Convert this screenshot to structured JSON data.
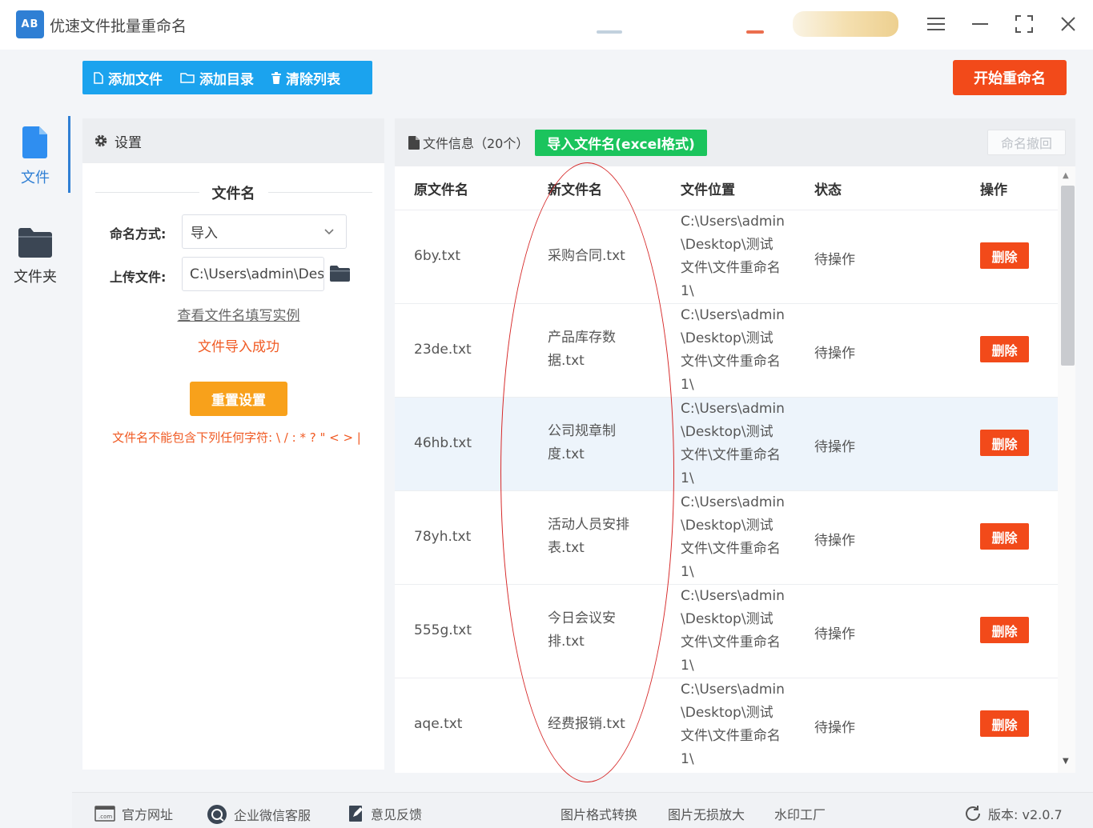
{
  "window": {
    "title": "优速文件批量重命名",
    "logo_text": "AB",
    "controls": [
      "menu-icon",
      "minimize-icon",
      "fullscreen-icon",
      "close-icon"
    ]
  },
  "nav": {
    "items": [
      {
        "label": "文件",
        "icon": "file-icon",
        "active": true
      },
      {
        "label": "文件夹",
        "icon": "folder-icon",
        "active": false
      }
    ]
  },
  "toolbar": {
    "add_files": "添加文件",
    "add_folder": "添加目录",
    "clear_list": "清除列表",
    "start_rename": "开始重命名"
  },
  "settings": {
    "header": "设置",
    "section_title": "文件名",
    "naming_mode_label": "命名方式:",
    "naming_mode_value": "导入",
    "upload_label": "上传文件:",
    "upload_value": "C:\\Users\\admin\\Desktop",
    "example_link": "查看文件名填写实例",
    "import_status": "文件导入成功",
    "reset_button": "重置设置",
    "warning": "文件名不能包含下列任何字符: \\ / : * ? \" < > |"
  },
  "file_table": {
    "info_label": "文件信息（20个）",
    "import_excel_button": "导入文件名(excel格式)",
    "undo_button": "命名撤回",
    "columns": [
      "原文件名",
      "新文件名",
      "文件位置",
      "状态",
      "操作"
    ],
    "rows": [
      {
        "original": "6by.txt",
        "new_line1": "采购合同.txt",
        "new_line2": "",
        "location": "C:\\Users\\admin\\Desktop\\测试文件\\文件重命名1\\",
        "status": "待操作",
        "action": "删除"
      },
      {
        "original": "23de.txt",
        "new_line1": "产品库存数",
        "new_line2": "据.txt",
        "location": "C:\\Users\\admin\\Desktop\\测试文件\\文件重命名1\\",
        "status": "待操作",
        "action": "删除"
      },
      {
        "original": "46hb.txt",
        "new_line1": "公司规章制",
        "new_line2": "度.txt",
        "location": "C:\\Users\\admin\\Desktop\\测试文件\\文件重命名1\\",
        "status": "待操作",
        "action": "删除"
      },
      {
        "original": "78yh.txt",
        "new_line1": "活动人员安排",
        "new_line2": "表.txt",
        "location": "C:\\Users\\admin\\Desktop\\测试文件\\文件重命名1\\",
        "status": "待操作",
        "action": "删除"
      },
      {
        "original": "555g.txt",
        "new_line1": "今日会议安",
        "new_line2": "排.txt",
        "location": "C:\\Users\\admin\\Desktop\\测试文件\\文件重命名1\\",
        "status": "待操作",
        "action": "删除"
      },
      {
        "original": "aqe.txt",
        "new_line1": "经费报销.txt",
        "new_line2": "",
        "location": "C:\\Users\\admin\\Desktop\\测试文件\\文件重命名1\\",
        "status": "待操作",
        "action": "删除"
      }
    ]
  },
  "footer": {
    "official_site": "官方网址",
    "wechat_support": "企业微信客服",
    "feedback": "意见反馈",
    "image_convert": "图片格式转换",
    "image_enlarge": "图片无损放大",
    "watermark": "水印工厂",
    "version": "版本: v2.0.7"
  },
  "colors": {
    "primary_blue": "#1ba3ee",
    "accent_red": "#f24a1a",
    "green": "#1bc45d",
    "orange": "#f8a11b",
    "annotation_red": "#d62828"
  }
}
